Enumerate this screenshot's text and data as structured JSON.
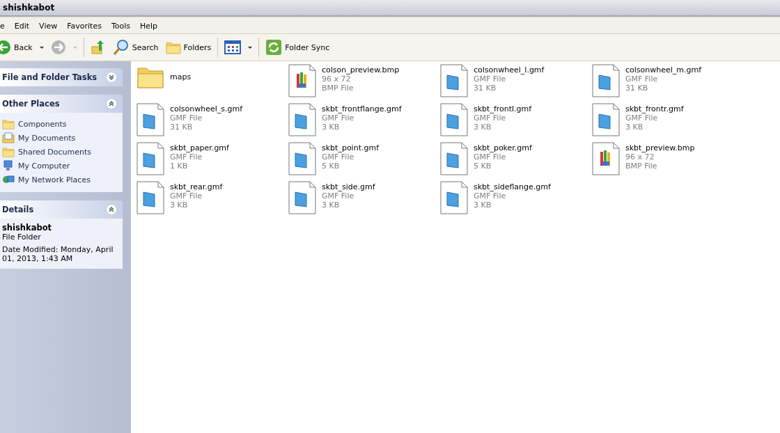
{
  "window": {
    "title": "shishkabot"
  },
  "menu": [
    "e",
    "Edit",
    "View",
    "Favorites",
    "Tools",
    "Help"
  ],
  "toolbar": [
    {
      "kind": "back",
      "label": "Back"
    },
    {
      "kind": "forward",
      "disabled": true
    },
    {
      "kind": "up"
    },
    {
      "kind": "search",
      "label": "Search"
    },
    {
      "kind": "folders",
      "label": "Folders"
    },
    {
      "kind": "views"
    },
    {
      "kind": "sync",
      "label": "Folder Sync"
    }
  ],
  "sidebar": {
    "panels": [
      {
        "title": "File and Folder Tasks",
        "expanded": false
      },
      {
        "kind": "places",
        "title": "Other Places",
        "expanded": true,
        "items": [
          {
            "kind": "folder",
            "label": "Components"
          },
          {
            "kind": "documents",
            "label": "My Documents"
          },
          {
            "kind": "folder",
            "label": "Shared Documents"
          },
          {
            "kind": "computer",
            "label": "My Computer"
          },
          {
            "kind": "network",
            "label": "My Network Places"
          }
        ]
      },
      {
        "kind": "details",
        "title": "Details",
        "expanded": true,
        "name": "shishkabot",
        "type": "File Folder",
        "modified": "Date Modified: Monday, April 01, 2013, 1:43 AM"
      }
    ]
  },
  "files": [
    {
      "kind": "folder",
      "name": "maps"
    },
    {
      "kind": "bmp",
      "name": "colson_preview.bmp",
      "line_2": "96 x 72",
      "line_3": "BMP File"
    },
    {
      "kind": "gmf",
      "name": "colsonwheel_l.gmf",
      "line_2": "GMF File",
      "line_3": "31 KB"
    },
    {
      "kind": "gmf",
      "name": "colsonwheel_m.gmf",
      "line_2": "GMF File",
      "line_3": "31 KB"
    },
    {
      "kind": "gmf",
      "name": "colsonwheel_s.gmf",
      "line_2": "GMF File",
      "line_3": "31 KB"
    },
    {
      "kind": "gmf",
      "name": "skbt_frontflange.gmf",
      "line_2": "GMF File",
      "line_3": "3 KB"
    },
    {
      "kind": "gmf",
      "name": "skbt_frontl.gmf",
      "line_2": "GMF File",
      "line_3": "3 KB"
    },
    {
      "kind": "gmf",
      "name": "skbt_frontr.gmf",
      "line_2": "GMF File",
      "line_3": "3 KB"
    },
    {
      "kind": "gmf",
      "name": "skbt_paper.gmf",
      "line_2": "GMF File",
      "line_3": "1 KB"
    },
    {
      "kind": "gmf",
      "name": "skbt_point.gmf",
      "line_2": "GMF File",
      "line_3": "5 KB"
    },
    {
      "kind": "gmf",
      "name": "skbt_poker.gmf",
      "line_2": "GMF File",
      "line_3": "5 KB"
    },
    {
      "kind": "bmp",
      "name": "skbt_preview.bmp",
      "line_2": "96 x 72",
      "line_3": "BMP File"
    },
    {
      "kind": "gmf",
      "name": "skbt_rear.gmf",
      "line_2": "GMF File",
      "line_3": "3 KB"
    },
    {
      "kind": "gmf",
      "name": "skbt_side.gmf",
      "line_2": "GMF File",
      "line_3": "3 KB"
    },
    {
      "kind": "gmf",
      "name": "skbt_sideflange.gmf",
      "line_2": "GMF File",
      "line_3": "3 KB"
    }
  ]
}
